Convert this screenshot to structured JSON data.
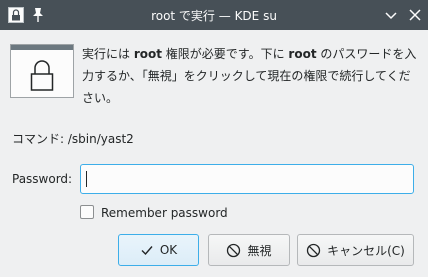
{
  "window": {
    "title": "root で実行 — KDE su"
  },
  "message": {
    "part1": "実行には ",
    "bold1": "root",
    "part2": " 権限が必要です。下に ",
    "bold2": "root",
    "part3": " のパスワードを入力するか、「無視」をクリックして現在の権限で続行してください。"
  },
  "command": {
    "label": "コマンド:",
    "value": "/sbin/yast2"
  },
  "password": {
    "label": "Password:",
    "value": ""
  },
  "remember": {
    "label": "Remember password",
    "checked": false
  },
  "buttons": {
    "ok": "OK",
    "ignore": "無視",
    "cancel": "キャンセル(C)"
  },
  "icons": {
    "app": "lock-icon",
    "pin": "pin-icon",
    "minimize": "chevron-down-icon",
    "close": "close-icon",
    "ok": "check-icon",
    "ignore": "no-entry-icon",
    "cancel": "no-entry-icon"
  },
  "colors": {
    "titlebar": "#475057",
    "accent": "#3daee9",
    "background": "#eff0f1"
  }
}
